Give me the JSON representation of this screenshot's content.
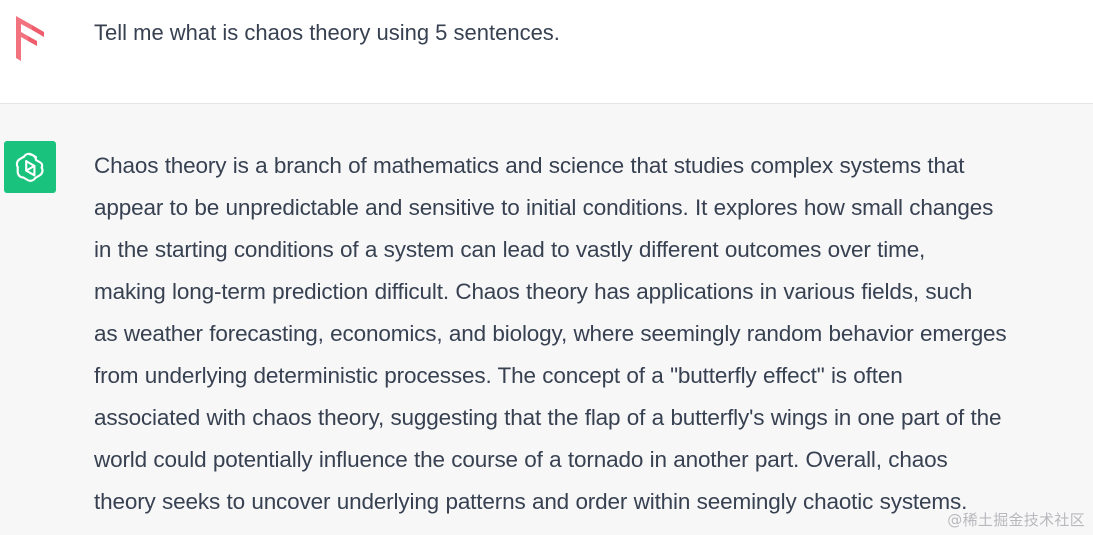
{
  "conversation": {
    "user_message": {
      "avatar_icon": "user-avatar-logo-icon",
      "text": "Tell me what is chaos theory using 5 sentences."
    },
    "assistant_message": {
      "avatar_icon": "chatgpt-logo-icon",
      "lines": [
        "Chaos theory is a branch of mathematics and science that studies complex systems that",
        "appear to be unpredictable and sensitive to initial conditions. It explores how small changes",
        "in the starting conditions of a system can lead to vastly different outcomes over time,",
        "making long-term prediction difficult. Chaos theory has applications in various fields, such",
        "as weather forecasting, economics, and biology, where seemingly random behavior emerges",
        "from underlying deterministic processes. The concept of a \"butterfly effect\" is often",
        "associated with chaos theory, suggesting that the flap of a butterfly's wings in one part of the",
        "world could potentially influence the course of a tornado in another part. Overall, chaos",
        "theory seeks to uncover underlying patterns and order within seemingly chaotic systems."
      ]
    }
  },
  "watermark": "@稀土掘金技术社区",
  "colors": {
    "user_logo": "#f2727d",
    "assistant_avatar_bg": "#19c37d",
    "assistant_row_bg": "#f7f7f8",
    "text": "#374151"
  }
}
